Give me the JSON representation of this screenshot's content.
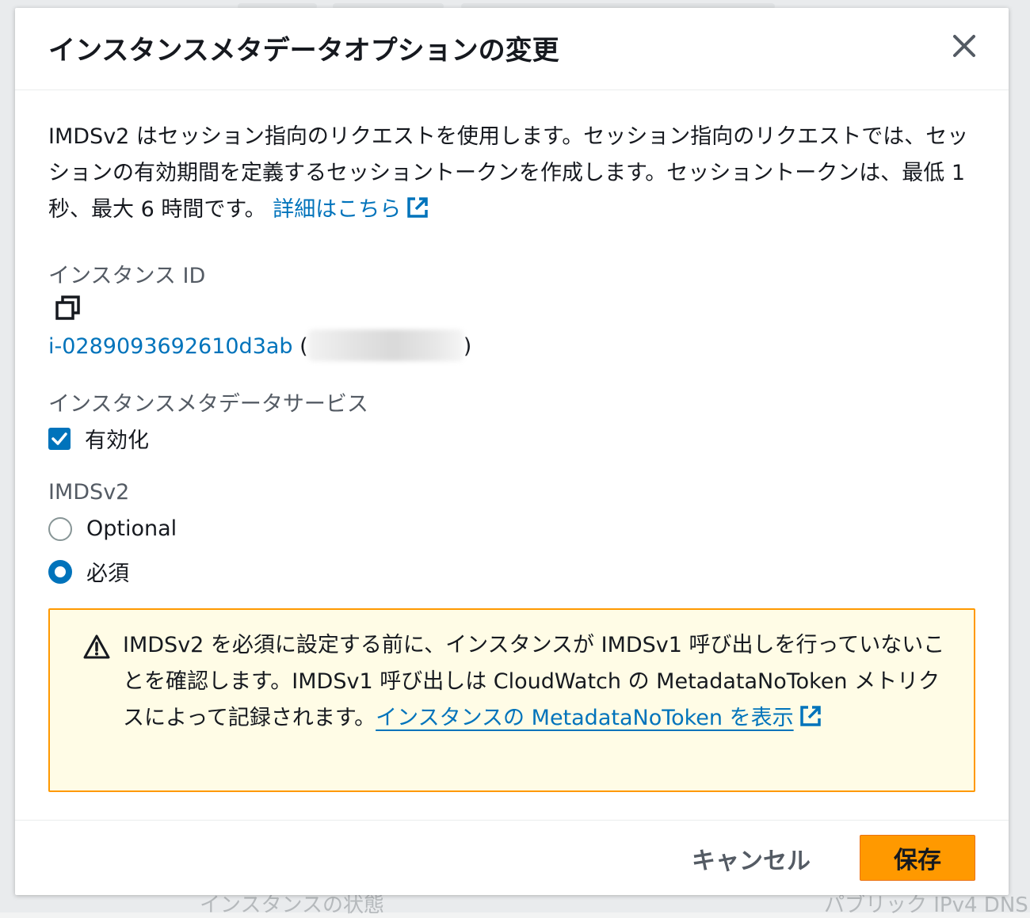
{
  "background": {
    "bottom_left_text": "インスタンスの状態",
    "bottom_right_text": "パブリック IPv4 DNS"
  },
  "modal": {
    "title": "インスタンスメタデータオプションの変更",
    "close_icon": "close-icon",
    "description": "IMDSv2 はセッション指向のリクエストを使用します。セッション指向のリクエストでは、セッションの有効期間を定義するセッショントークンを作成します。セッショントークンは、最低 1 秒、最大 6 時間です。",
    "learn_more_link": "詳細はこちら",
    "instance_id_label": "インスタンス ID",
    "instance_id_value": "i-0289093692610d3ab",
    "instance_id_open_paren": "(",
    "instance_id_close_paren": ")",
    "metadata_service_label": "インスタンスメタデータサービス",
    "metadata_service_checkbox": {
      "label": "有効化",
      "checked": true
    },
    "imdsv2_label": "IMDSv2",
    "imdsv2_options": [
      {
        "label": "Optional",
        "checked": false
      },
      {
        "label": "必須",
        "checked": true
      }
    ],
    "warning": {
      "text": "IMDSv2 を必須に設定する前に、インスタンスが IMDSv1 呼び出しを行っていないことを確認します。IMDSv1 呼び出しは CloudWatch の MetadataNoToken メトリクスによって記録されます。",
      "link": "インスタンスの MetadataNoToken を表示"
    },
    "cancel_label": "キャンセル",
    "save_label": "保存"
  },
  "colors": {
    "link": "#0073bb",
    "primary_button": "#ff9900",
    "warning_border": "#ff9900",
    "warning_bg": "#fffce6"
  }
}
